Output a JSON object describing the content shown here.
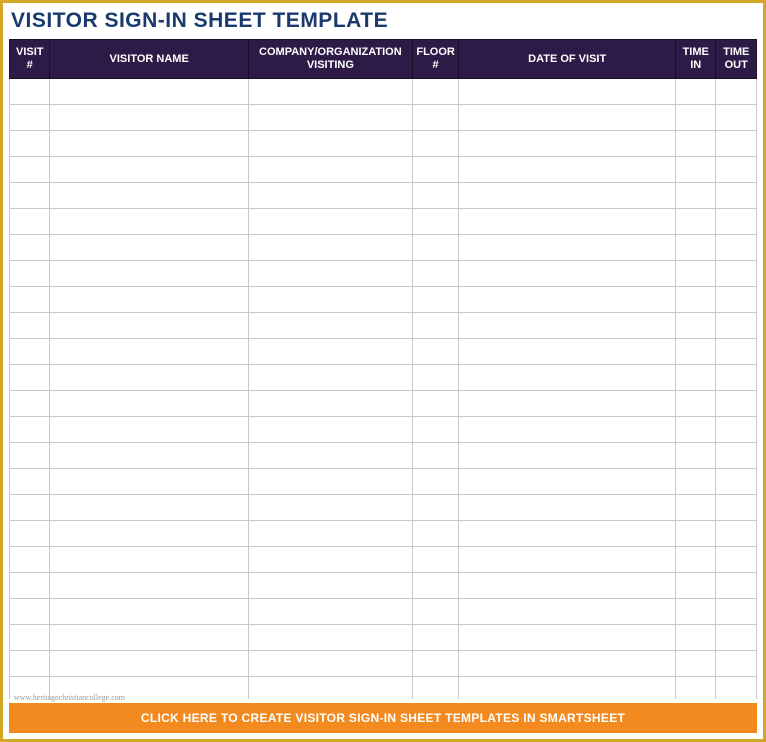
{
  "title": "VISITOR SIGN-IN SHEET TEMPLATE",
  "columns": [
    {
      "key": "visit",
      "label": "VISIT #"
    },
    {
      "key": "name",
      "label": "VISITOR NAME"
    },
    {
      "key": "company",
      "label": "COMPANY/ORGANIZATION VISITING"
    },
    {
      "key": "floor",
      "label": "FLOOR #"
    },
    {
      "key": "date",
      "label": "DATE OF VISIT"
    },
    {
      "key": "timein",
      "label": "TIME IN"
    },
    {
      "key": "timeout",
      "label": "TIME OUT"
    }
  ],
  "row_count": 24,
  "watermark": "www.heritagechristiancollege.com",
  "cta": "CLICK HERE TO CREATE VISITOR SIGN-IN SHEET TEMPLATES IN SMARTSHEET"
}
